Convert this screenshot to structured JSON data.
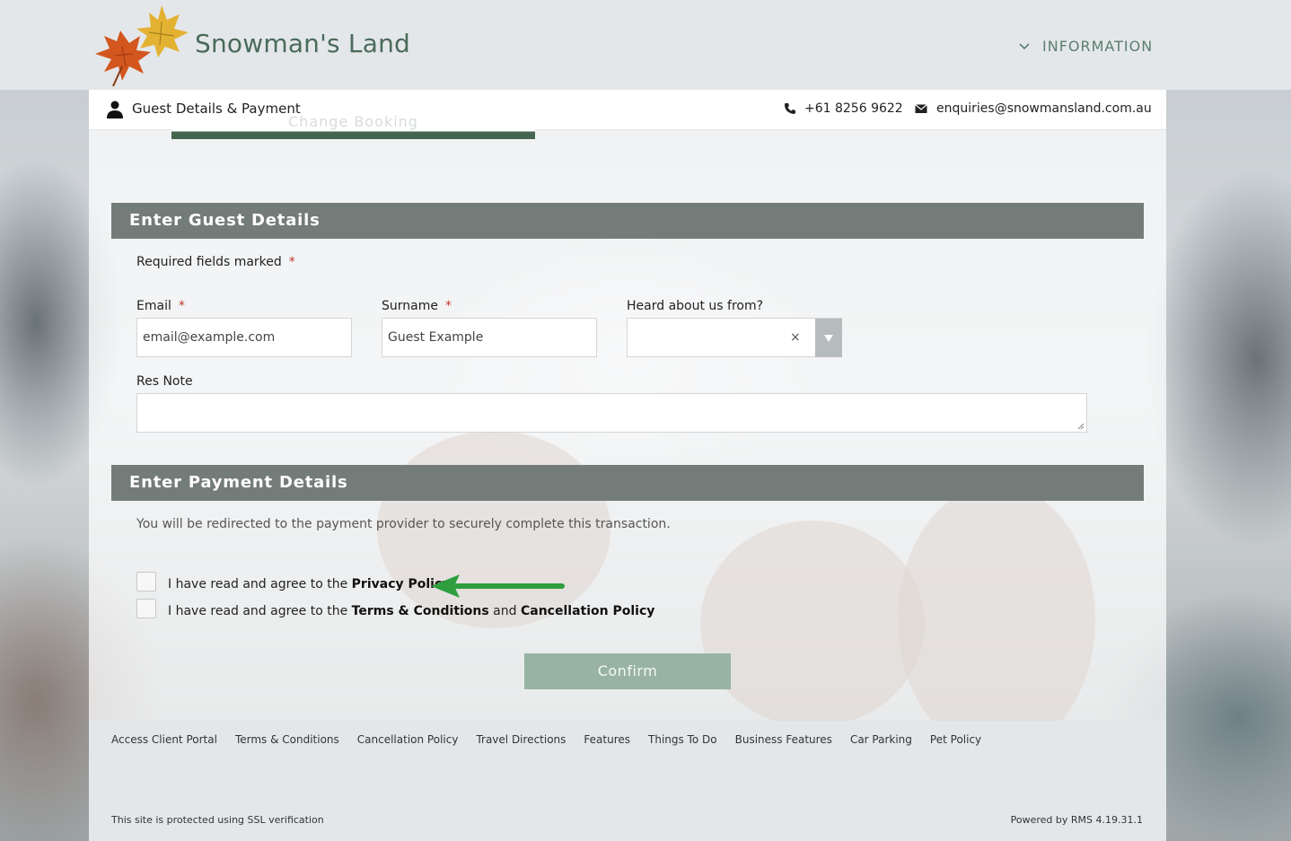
{
  "header": {
    "site_name": "Snowman's Land",
    "info_menu": "INFORMATION"
  },
  "topbar": {
    "title": "Guest Details & Payment",
    "change_booking": "Change Booking",
    "phone": "+61 8256 9622",
    "email": "enquiries@snowmansland.com.au"
  },
  "guest_section": {
    "heading": "Enter Guest Details",
    "required_note": "Required fields marked",
    "required_marker": "*",
    "email_label": "Email",
    "email_value": "email@example.com",
    "surname_label": "Surname",
    "surname_value": "Guest Example",
    "heard_label": "Heard about us from?",
    "heard_clear": "×",
    "res_note_label": "Res Note"
  },
  "payment_section": {
    "heading": "Enter Payment Details",
    "redirect_text": "You will be redirected to the payment provider to securely complete this transaction.",
    "privacy_prefix": "I have read and agree to the ",
    "privacy_link": "Privacy Policy",
    "terms_prefix": "I have read and agree to the ",
    "terms_link": "Terms & Conditions",
    "terms_and": " and ",
    "cancellation_link": "Cancellation Policy",
    "confirm": "Confirm"
  },
  "footer": {
    "links": [
      "Access Client Portal",
      "Terms & Conditions",
      "Cancellation Policy",
      "Travel Directions",
      "Features",
      "Things To Do",
      "Business Features",
      "Car Parking",
      "Pet Policy"
    ],
    "ssl_note": "This site is protected using SSL verification",
    "powered_by": "Powered by RMS 4.19.31.1"
  },
  "colors": {
    "section_bar": "#747c79",
    "brand_green": "#4a6b5a",
    "confirm_bg": "#98b3a3",
    "annotation_arrow": "#2e9e3e",
    "required": "#c0392b"
  }
}
